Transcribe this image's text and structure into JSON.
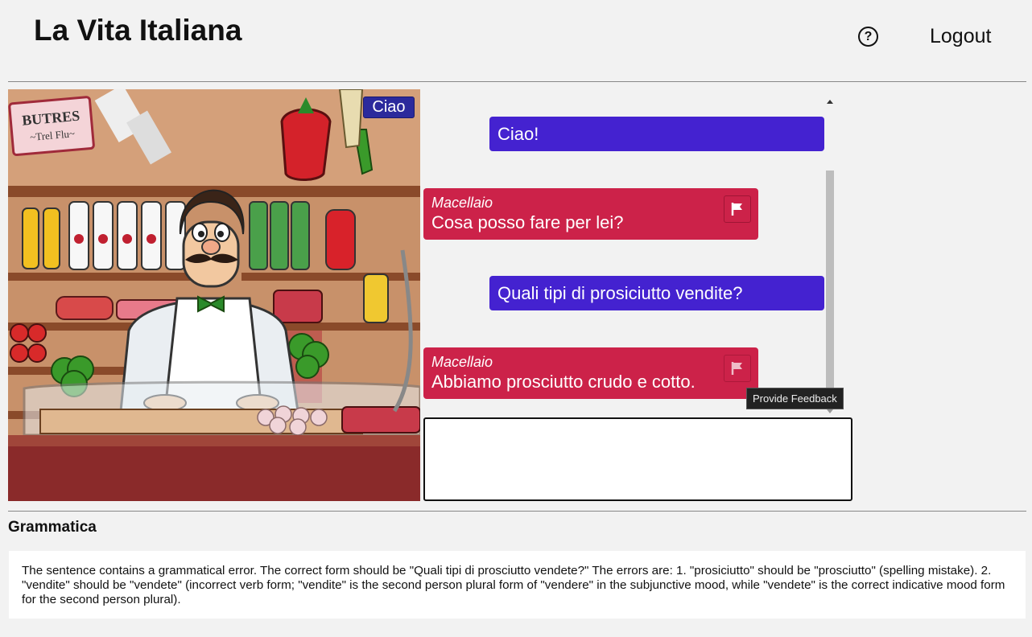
{
  "header": {
    "app_title": "La Vita Italiana",
    "help_icon": "question-circle-icon",
    "help_label": "?",
    "logout_label": "Logout"
  },
  "scene": {
    "label": "Ciao",
    "shop_sign": "BUTRES",
    "shop_sign_sub": "~Trel Flu~"
  },
  "chat": {
    "messages": [
      {
        "role": "user",
        "text": "Ciao!"
      },
      {
        "role": "bot",
        "speaker": "Macellaio",
        "text": "Cosa posso fare per lei?"
      },
      {
        "role": "user",
        "text": "Quali tipi di prosiciutto vendite?"
      },
      {
        "role": "bot",
        "speaker": "Macellaio",
        "text": "Abbiamo prosciutto crudo e cotto."
      }
    ],
    "flag_icon": "flag-icon",
    "tooltip": "Provide Feedback",
    "input_value": "",
    "colors": {
      "user_bubble": "#4422d0",
      "bot_bubble": "#cc2249"
    }
  },
  "grammar": {
    "title": "Grammatica",
    "feedback": "The sentence contains a grammatical error. The correct form should be \"Quali tipi di prosciutto vendete?\" The errors are: 1. \"prosiciutto\" should be \"prosciutto\" (spelling mistake). 2. \"vendite\" should be \"vendete\" (incorrect verb form; \"vendite\" is the second person plural form of \"vendere\" in the subjunctive mood, while \"vendete\" is the correct indicative mood form for the second person plural)."
  }
}
